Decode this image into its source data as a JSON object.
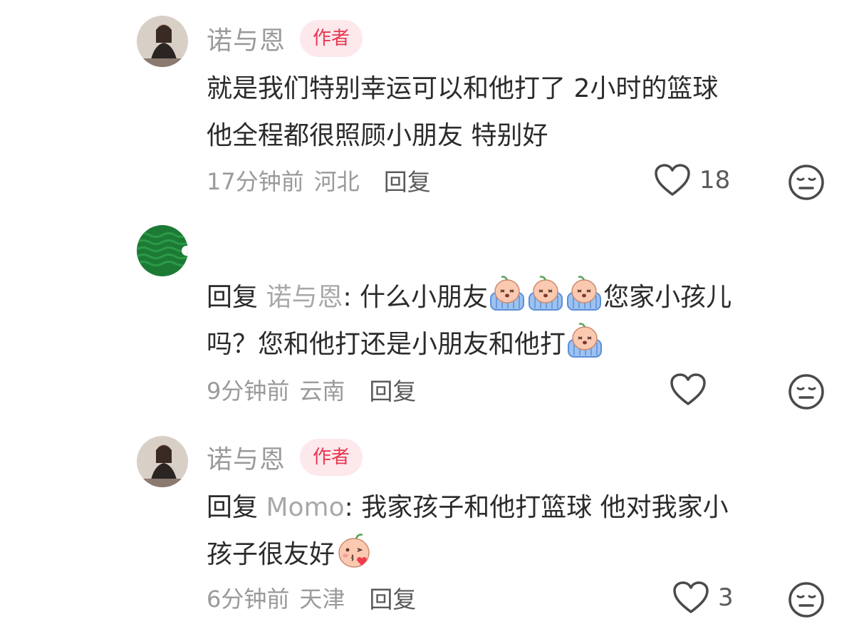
{
  "comments": [
    {
      "username": "诺与恩",
      "badge": "作者",
      "text_line1": "就是我们特别幸运可以和他打了 2小时的篮球",
      "text_line2": "他全程都很照顾小朋友 特别好",
      "time": "17分钟前",
      "location": "河北",
      "reply_label": "回复",
      "like_count": "18"
    },
    {
      "reply_prefix": "回复",
      "reply_target": "诺与恩",
      "text_a": ": 什么小朋友",
      "text_b": "您家小孩儿",
      "text_line2": "吗？您和他打还是小朋友和他打",
      "time": "9分钟前",
      "location": "云南",
      "reply_label": "回复",
      "like_count": ""
    },
    {
      "username": "诺与恩",
      "badge": "作者",
      "reply_prefix": "回复",
      "reply_target": "Momo",
      "text_a": ": 我家孩子和他打篮球 他对我家小",
      "text_line2": "孩子很友好",
      "time": "6分钟前",
      "location": "天津",
      "reply_label": "回复",
      "like_count": "3"
    }
  ],
  "icons": {
    "like": "heart-outline-icon",
    "dislike": "neutral-face-icon",
    "emoji_cry": "crying-emoji",
    "emoji_kiss": "kissing-emoji"
  },
  "colors": {
    "badge_bg": "#fde8ec",
    "badge_text": "#e8364f",
    "muted": "#9a9a9a",
    "text": "#2b2b2b"
  }
}
